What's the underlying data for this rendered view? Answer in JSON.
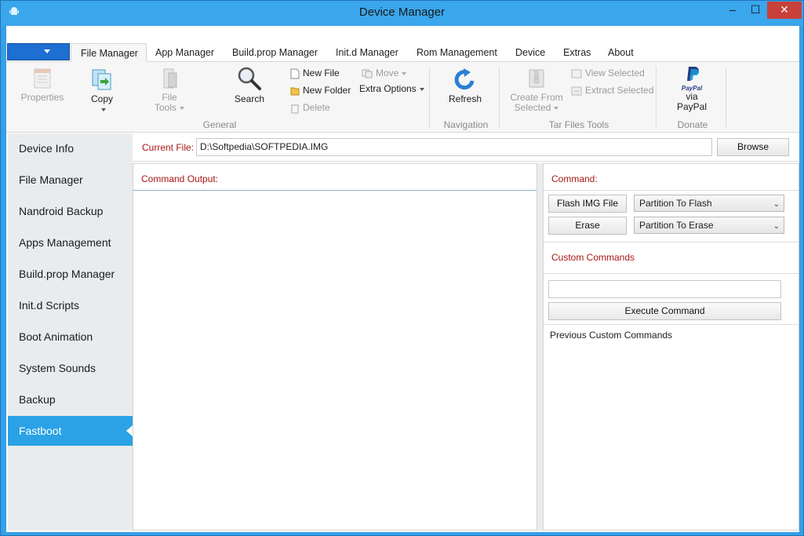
{
  "window": {
    "title": "Device Manager"
  },
  "titlebar_buttons": {
    "minimize": "–",
    "maximize": "☐",
    "close": "✕"
  },
  "tabs": [
    "File Manager",
    "App Manager",
    "Build.prop Manager",
    "Init.d Manager",
    "Rom Management",
    "Device",
    "Extras",
    "About"
  ],
  "ribbon": {
    "properties": "Properties",
    "copy": "Copy",
    "file_tools_1": "File",
    "file_tools_2": "Tools",
    "search": "Search",
    "new_file": "New File",
    "new_folder": "New Folder",
    "delete": "Delete",
    "move": "Move",
    "extra_options": "Extra Options",
    "group_general": "General",
    "refresh": "Refresh",
    "group_navigation": "Navigation",
    "create_from_1": "Create From",
    "create_from_2": "Selected",
    "view_selected": "View Selected",
    "extract_selected": "Extract Selected",
    "group_tar": "Tar Files Tools",
    "paypal_logo": "PayPal",
    "paypal_1": "via",
    "paypal_2": "PayPal",
    "group_donate": "Donate"
  },
  "sidebar": {
    "items": [
      {
        "label": "Device Info"
      },
      {
        "label": "File Manager"
      },
      {
        "label": "Nandroid Backup"
      },
      {
        "label": "Apps Management"
      },
      {
        "label": "Build.prop Manager"
      },
      {
        "label": "Init.d Scripts"
      },
      {
        "label": "Boot Animation"
      },
      {
        "label": "System Sounds"
      },
      {
        "label": "Backup"
      },
      {
        "label": "Fastboot"
      }
    ],
    "active_index": 9
  },
  "filebar": {
    "label": "Current File:",
    "value": "D:\\Softpedia\\SOFTPEDIA.IMG",
    "browse": "Browse"
  },
  "output": {
    "label": "Command Output:"
  },
  "command": {
    "label": "Command:",
    "flash_button": "Flash IMG File",
    "erase_button": "Erase",
    "flash_partition": "Partition To Flash",
    "erase_partition": "Partition To Erase",
    "custom_label": "Custom Commands",
    "custom_value": "",
    "execute_button": "Execute Command",
    "previous_label": "Previous Custom Commands"
  },
  "colors": {
    "accent": "#2aa2e5",
    "title_blue": "#3aa6ec",
    "label_red": "#a81612"
  }
}
